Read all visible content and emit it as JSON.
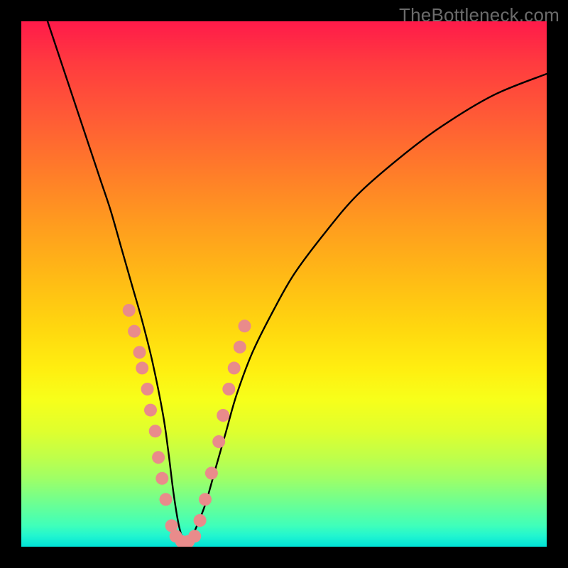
{
  "watermark": "TheBottleneck.com",
  "chart_data": {
    "type": "line",
    "title": "",
    "xlabel": "",
    "ylabel": "",
    "xlim": [
      0,
      100
    ],
    "ylim": [
      0,
      100
    ],
    "grid": false,
    "annotations": [
      "TheBottleneck.com"
    ],
    "series": [
      {
        "name": "curve",
        "x": [
          5,
          7,
          9,
          11,
          13,
          15,
          17,
          19,
          21,
          23,
          25,
          27,
          28,
          29,
          30,
          31,
          32,
          33,
          35,
          37,
          39,
          41,
          44,
          48,
          52,
          58,
          64,
          72,
          80,
          90,
          100
        ],
        "values": [
          100,
          94,
          88,
          82,
          76,
          70,
          64,
          57,
          50,
          43,
          35,
          25,
          18,
          10,
          4,
          1,
          1,
          3,
          8,
          15,
          22,
          29,
          37,
          45,
          52,
          60,
          67,
          74,
          80,
          86,
          90
        ]
      }
    ],
    "markers": [
      {
        "x": 20.5,
        "y": 45
      },
      {
        "x": 21.5,
        "y": 41
      },
      {
        "x": 22.5,
        "y": 37
      },
      {
        "x": 23.0,
        "y": 34
      },
      {
        "x": 24.0,
        "y": 30
      },
      {
        "x": 24.6,
        "y": 26
      },
      {
        "x": 25.5,
        "y": 22
      },
      {
        "x": 26.1,
        "y": 17
      },
      {
        "x": 26.8,
        "y": 13
      },
      {
        "x": 27.5,
        "y": 9
      },
      {
        "x": 28.6,
        "y": 4
      },
      {
        "x": 29.4,
        "y": 2
      },
      {
        "x": 30.5,
        "y": 1
      },
      {
        "x": 31.8,
        "y": 1
      },
      {
        "x": 33.0,
        "y": 2
      },
      {
        "x": 34.0,
        "y": 5
      },
      {
        "x": 35.0,
        "y": 9
      },
      {
        "x": 36.2,
        "y": 14
      },
      {
        "x": 37.6,
        "y": 20
      },
      {
        "x": 38.4,
        "y": 25
      },
      {
        "x": 39.5,
        "y": 30
      },
      {
        "x": 40.5,
        "y": 34
      },
      {
        "x": 41.6,
        "y": 38
      },
      {
        "x": 42.5,
        "y": 42
      }
    ]
  }
}
